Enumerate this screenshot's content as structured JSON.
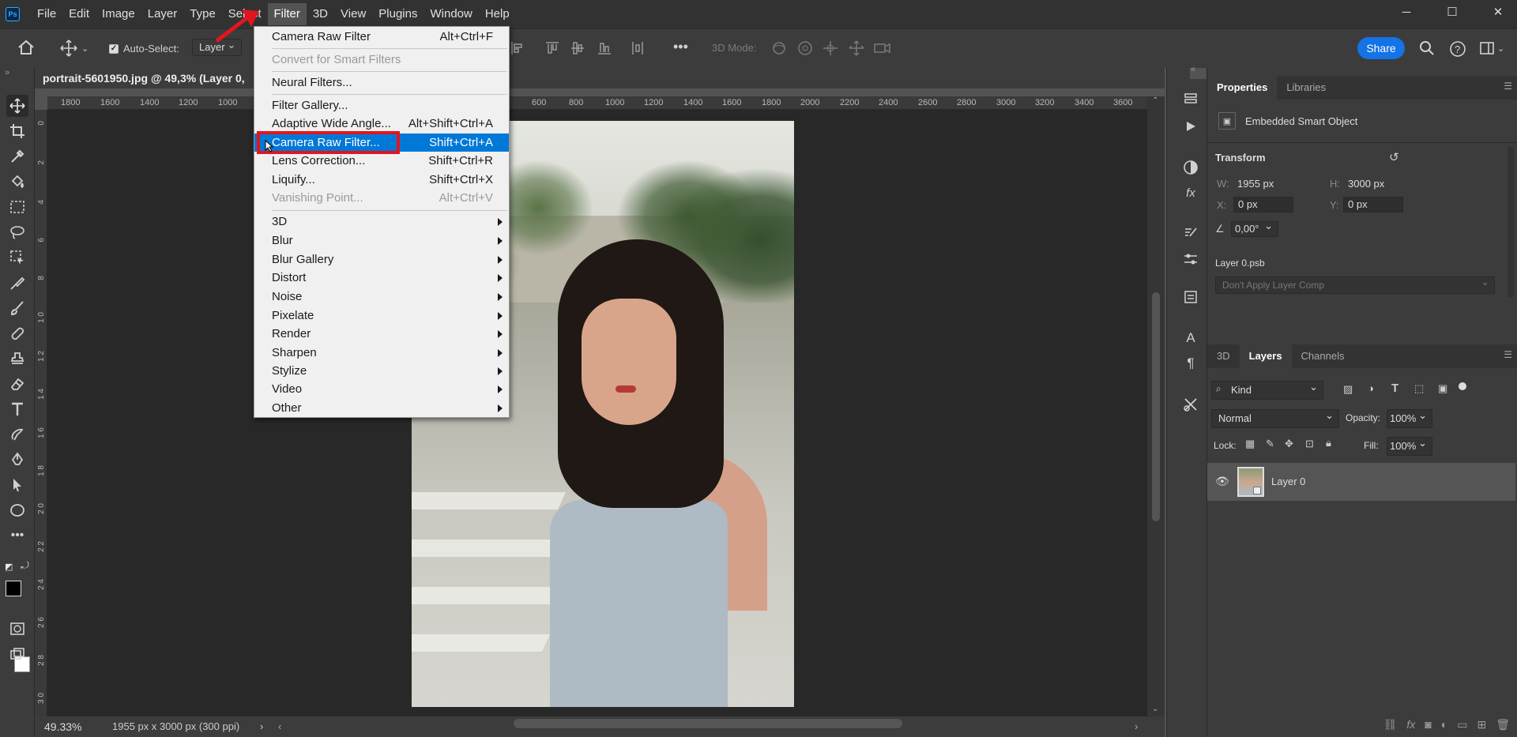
{
  "menubar": {
    "logo": "Ps",
    "items": [
      "File",
      "Edit",
      "Image",
      "Layer",
      "Type",
      "Select",
      "Filter",
      "3D",
      "View",
      "Plugins",
      "Window",
      "Help"
    ],
    "active": "Filter",
    "window_controls": [
      "─",
      "☐",
      "✕"
    ]
  },
  "optionsbar": {
    "auto_select_label": "Auto-Select:",
    "auto_select_checked": true,
    "auto_select_target": "Layer",
    "three_d_mode_label": "3D Mode:",
    "share_label": "Share"
  },
  "document": {
    "tab_title": "portrait-5601950.jpg @ 49,3% (Layer 0,",
    "zoom": "49.33%",
    "info": "1955 px x 3000 px (300 ppi)",
    "ruler_top": [
      "1800",
      "1600",
      "1400",
      "1200",
      "1000",
      "600",
      "800",
      "1000",
      "1200",
      "1400",
      "1600",
      "1800",
      "2000",
      "2200",
      "2400",
      "2600",
      "2800",
      "3000",
      "3200",
      "3400",
      "3600"
    ],
    "ruler_left": [
      "0",
      "2",
      "4",
      "6",
      "8",
      "1\n0",
      "1\n2",
      "1\n4",
      "1\n6",
      "1\n8",
      "2\n0",
      "2\n2",
      "2\n4",
      "2\n6",
      "2\n8",
      "3\n0"
    ]
  },
  "filter_menu": {
    "items": [
      {
        "label": "Camera Raw Filter",
        "shortcut": "Alt+Ctrl+F",
        "state": "normal"
      },
      {
        "label": "Convert for Smart Filters",
        "shortcut": "",
        "state": "disabled"
      },
      {
        "label": "Neural Filters...",
        "shortcut": "",
        "state": "normal"
      },
      {
        "label": "Filter Gallery...",
        "shortcut": "",
        "state": "normal"
      },
      {
        "label": "Adaptive Wide Angle...",
        "shortcut": "Alt+Shift+Ctrl+A",
        "state": "normal"
      },
      {
        "label": "Camera Raw Filter...",
        "shortcut": "Shift+Ctrl+A",
        "state": "highlight"
      },
      {
        "label": "Lens Correction...",
        "shortcut": "Shift+Ctrl+R",
        "state": "normal"
      },
      {
        "label": "Liquify...",
        "shortcut": "Shift+Ctrl+X",
        "state": "normal"
      },
      {
        "label": "Vanishing Point...",
        "shortcut": "Alt+Ctrl+V",
        "state": "disabled"
      },
      {
        "label": "3D",
        "submenu": true
      },
      {
        "label": "Blur",
        "submenu": true
      },
      {
        "label": "Blur Gallery",
        "submenu": true
      },
      {
        "label": "Distort",
        "submenu": true
      },
      {
        "label": "Noise",
        "submenu": true
      },
      {
        "label": "Pixelate",
        "submenu": true
      },
      {
        "label": "Render",
        "submenu": true
      },
      {
        "label": "Sharpen",
        "submenu": true
      },
      {
        "label": "Stylize",
        "submenu": true
      },
      {
        "label": "Video",
        "submenu": true
      },
      {
        "label": "Other",
        "submenu": true
      }
    ]
  },
  "properties": {
    "tabs": [
      "Properties",
      "Libraries"
    ],
    "object_type": "Embedded Smart Object",
    "transform_label": "Transform",
    "w_label": "W:",
    "w_value": "1955 px",
    "h_label": "H:",
    "h_value": "3000 px",
    "x_label": "X:",
    "x_value": "0 px",
    "y_label": "Y:",
    "y_value": "0 px",
    "angle_value": "0,00°",
    "linked_file": "Layer 0.psb",
    "layer_comp": "Don't Apply Layer Comp"
  },
  "layers": {
    "tabs": [
      "3D",
      "Layers",
      "Channels"
    ],
    "filter_kind": "Kind",
    "blend_mode": "Normal",
    "opacity_label": "Opacity:",
    "opacity_value": "100%",
    "lock_label": "Lock:",
    "fill_label": "Fill:",
    "fill_value": "100%",
    "items": [
      {
        "name": "Layer 0",
        "visible": true
      }
    ]
  },
  "footer_icons": [
    "link-icon",
    "fx-icon",
    "mask-icon",
    "adjustment-icon",
    "folder-icon",
    "new-layer-icon",
    "trash-icon"
  ]
}
